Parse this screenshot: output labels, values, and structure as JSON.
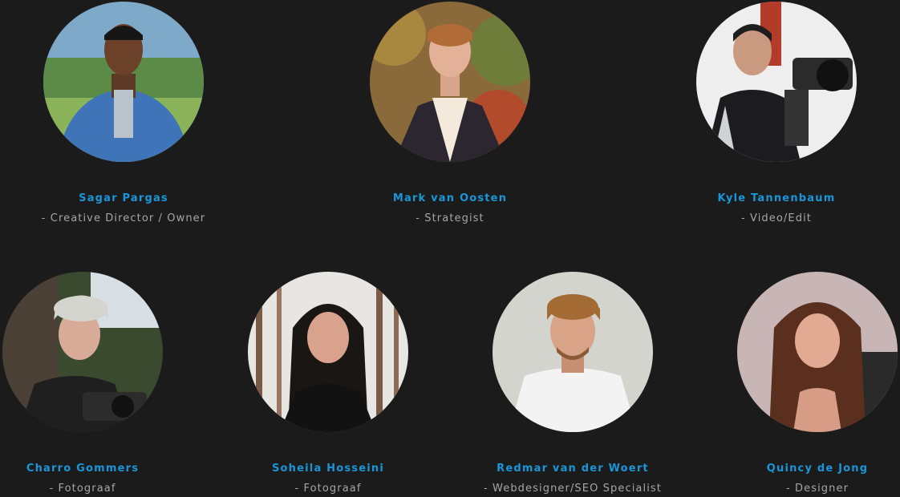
{
  "team": [
    {
      "name": "Sagar Pargas",
      "role": "- Creative Director / Owner"
    },
    {
      "name": "Mark van Oosten",
      "role": "- Strategist"
    },
    {
      "name": "Kyle Tannenbaum",
      "role": "- Video/Edit"
    },
    {
      "name": "Charro Gommers",
      "role": "- Fotograaf"
    },
    {
      "name": "Soheila Hosseini",
      "role": "- Fotograaf"
    },
    {
      "name": "Redmar van der Woert",
      "role": "- Webdesigner/SEO Specialist"
    },
    {
      "name": "Quincy de Jong",
      "role": "- Designer"
    }
  ],
  "colors": {
    "background": "#1b1b1b",
    "name": "#1996d8",
    "role": "#a6a6a6"
  }
}
